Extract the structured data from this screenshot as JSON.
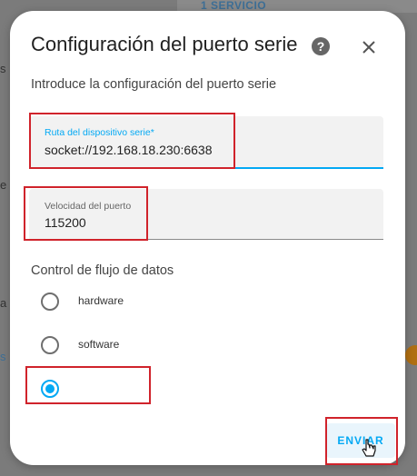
{
  "background": {
    "link_text": "1 SERVICIO",
    "edge_texts": [
      "s",
      "e",
      "a",
      "s"
    ]
  },
  "dialog": {
    "title": "Configuración del puerto serie",
    "subtitle": "Introduce la configuración del puerto serie",
    "help_icon": "help-circle-icon",
    "close_icon": "close-icon"
  },
  "fields": {
    "device_path": {
      "label": "Ruta del dispositivo serie*",
      "value": "socket://192.168.18.230:6638"
    },
    "baud_rate": {
      "label": "Velocidad del puerto",
      "value": "115200"
    }
  },
  "flow_control": {
    "label": "Control de flujo de datos",
    "options": [
      {
        "label": "hardware",
        "selected": false
      },
      {
        "label": "software",
        "selected": false
      },
      {
        "label": "",
        "selected": true
      }
    ]
  },
  "actions": {
    "submit_label": "ENVIAR"
  },
  "colors": {
    "accent": "#03a9f4",
    "highlight": "#d0232b"
  }
}
